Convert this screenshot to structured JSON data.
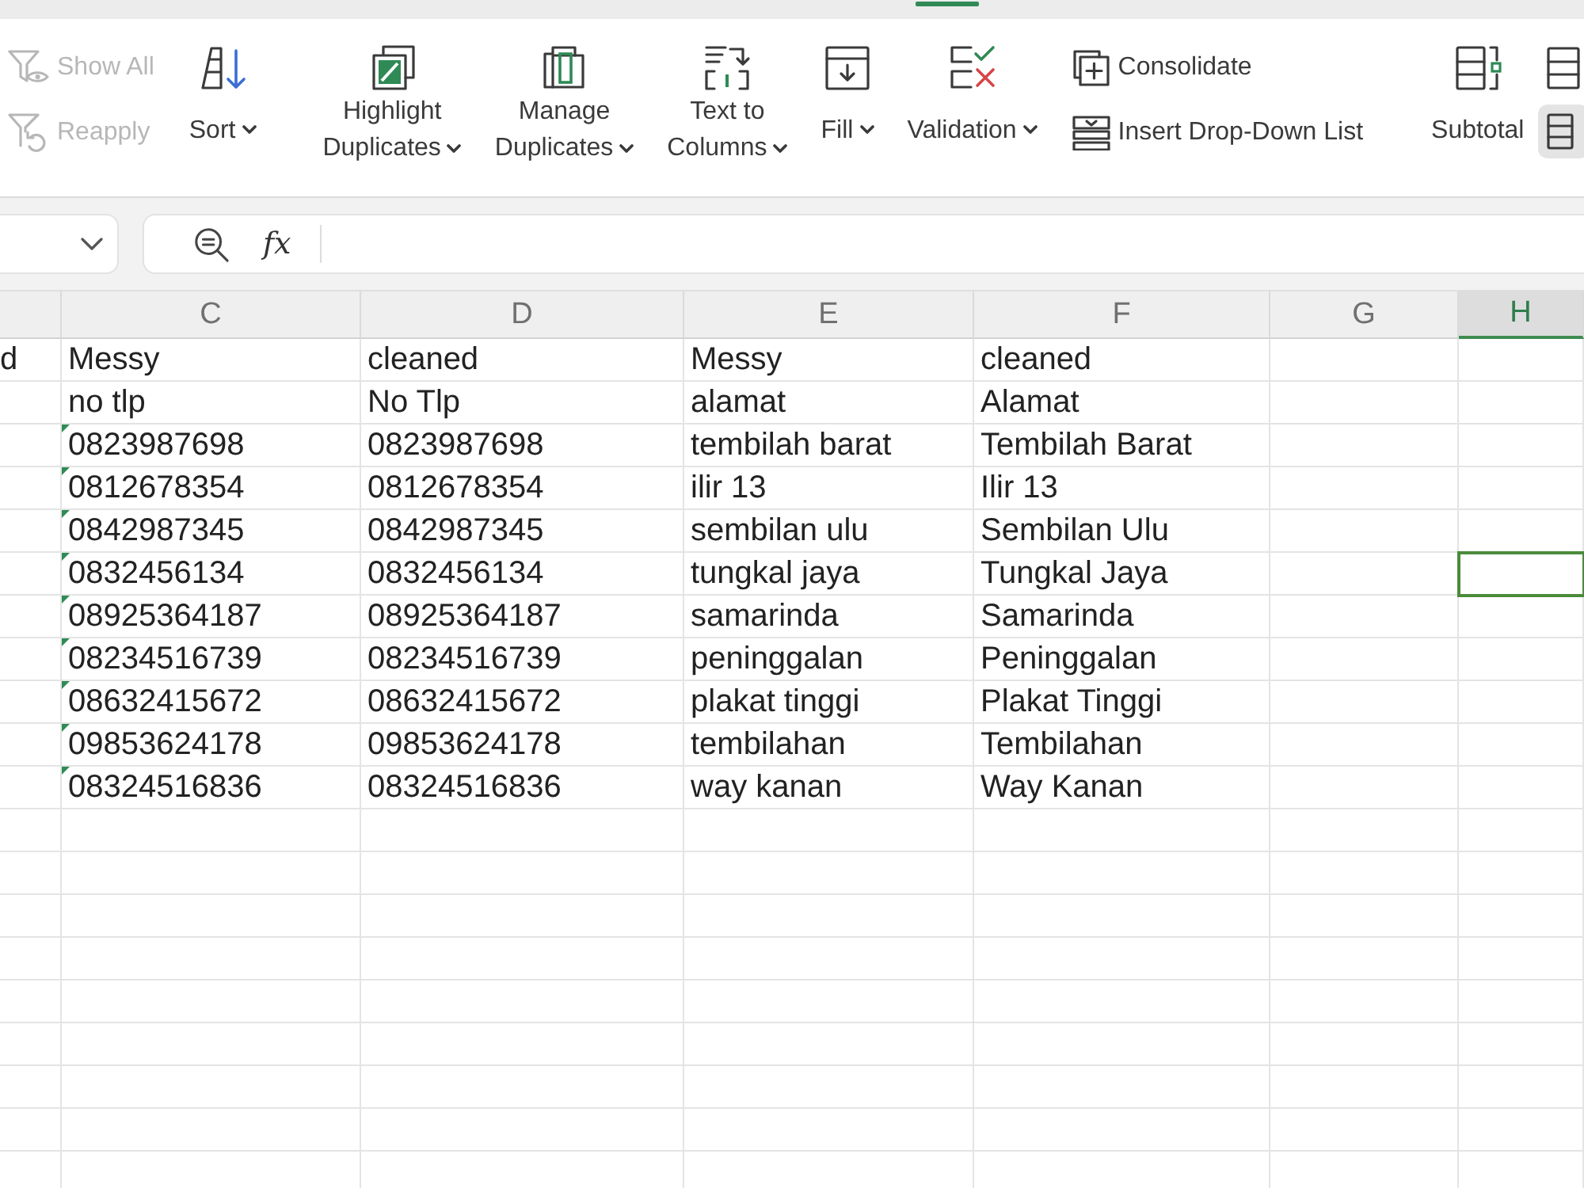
{
  "ribbon": {
    "groups": [
      {
        "controls": [
          {
            "kind": "stack",
            "items": [
              {
                "label": "Show All",
                "disabled": true
              },
              {
                "label": "Reapply",
                "disabled": true
              }
            ]
          },
          {
            "kind": "large",
            "lines": [
              "Sort"
            ],
            "dropdown": true
          }
        ]
      },
      {
        "controls": [
          {
            "kind": "large",
            "lines": [
              "Highlight",
              "Duplicates"
            ],
            "dropdown": true
          },
          {
            "kind": "large",
            "lines": [
              "Manage",
              "Duplicates"
            ],
            "dropdown": true
          },
          {
            "kind": "large",
            "lines": [
              "Text to",
              "Columns"
            ],
            "dropdown": true
          },
          {
            "kind": "large",
            "lines": [
              "Fill"
            ],
            "dropdown": true
          },
          {
            "kind": "large",
            "lines": [
              "Validation"
            ],
            "dropdown": true
          },
          {
            "kind": "stack",
            "items": [
              {
                "label": "Consolidate",
                "disabled": false
              },
              {
                "label": "Insert Drop-Down List",
                "disabled": false
              }
            ]
          }
        ]
      },
      {
        "controls": [
          {
            "kind": "large",
            "lines": [
              "Subtotal"
            ],
            "dropdown": false
          },
          {
            "kind": "icons",
            "items": [
              {
                "pressed": false
              },
              {
                "pressed": true
              }
            ]
          }
        ]
      }
    ]
  },
  "formula_bar": {
    "function_label": "fx"
  },
  "sheet": {
    "columns": [
      {
        "selected": false
      },
      {
        "letter": "C",
        "selected": false
      },
      {
        "letter": "D",
        "selected": false
      },
      {
        "letter": "E",
        "selected": false
      },
      {
        "letter": "F",
        "selected": false
      },
      {
        "letter": "G",
        "selected": false
      },
      {
        "letter": "H",
        "selected": true
      }
    ],
    "rows": [
      {
        "cells": [
          {
            "text": "d",
            "flagged": false
          },
          {
            "text": "Messy",
            "flagged": false
          },
          {
            "text": "cleaned",
            "flagged": false
          },
          {
            "text": "Messy",
            "flagged": false
          },
          {
            "text": "cleaned",
            "flagged": false
          }
        ]
      },
      {
        "cells": [
          null,
          {
            "text": "no tlp",
            "flagged": false
          },
          {
            "text": "No Tlp",
            "flagged": false
          },
          {
            "text": "alamat",
            "flagged": false
          },
          {
            "text": "Alamat",
            "flagged": false
          }
        ]
      },
      {
        "cells": [
          null,
          {
            "text": "0823987698",
            "flagged": true
          },
          {
            "text": "0823987698",
            "flagged": false
          },
          {
            "text": "tembilah barat",
            "flagged": false
          },
          {
            "text": "Tembilah Barat",
            "flagged": false
          }
        ]
      },
      {
        "cells": [
          null,
          {
            "text": "0812678354",
            "flagged": true
          },
          {
            "text": "0812678354",
            "flagged": false
          },
          {
            "text": "ilir 13",
            "flagged": false
          },
          {
            "text": "Ilir 13",
            "flagged": false
          }
        ]
      },
      {
        "cells": [
          null,
          {
            "text": "0842987345",
            "flagged": true
          },
          {
            "text": "0842987345",
            "flagged": false
          },
          {
            "text": "sembilan ulu",
            "flagged": false
          },
          {
            "text": "Sembilan Ulu",
            "flagged": false
          }
        ]
      },
      {
        "cells": [
          null,
          {
            "text": "0832456134",
            "flagged": true
          },
          {
            "text": "0832456134",
            "flagged": false
          },
          {
            "text": "tungkal jaya",
            "flagged": false
          },
          {
            "text": "Tungkal Jaya",
            "flagged": false
          },
          null,
          {
            "selected": true
          }
        ]
      },
      {
        "cells": [
          null,
          {
            "text": "08925364187",
            "flagged": true
          },
          {
            "text": "08925364187",
            "flagged": false
          },
          {
            "text": "samarinda",
            "flagged": false
          },
          {
            "text": "Samarinda",
            "flagged": false
          }
        ]
      },
      {
        "cells": [
          null,
          {
            "text": "08234516739",
            "flagged": true
          },
          {
            "text": "08234516739",
            "flagged": false
          },
          {
            "text": "peninggalan",
            "flagged": false
          },
          {
            "text": "Peninggalan",
            "flagged": false
          }
        ]
      },
      {
        "cells": [
          null,
          {
            "text": "08632415672",
            "flagged": true
          },
          {
            "text": "08632415672",
            "flagged": false
          },
          {
            "text": "plakat tinggi",
            "flagged": false
          },
          {
            "text": "Plakat Tinggi",
            "flagged": false
          }
        ]
      },
      {
        "cells": [
          null,
          {
            "text": "09853624178",
            "flagged": true
          },
          {
            "text": "09853624178",
            "flagged": false
          },
          {
            "text": "tembilahan",
            "flagged": false
          },
          {
            "text": "Tembilahan",
            "flagged": false
          }
        ]
      },
      {
        "cells": [
          null,
          {
            "text": "08324516836",
            "flagged": true
          },
          {
            "text": "08324516836",
            "flagged": false
          },
          {
            "text": "way kanan",
            "flagged": false
          },
          {
            "text": "Way Kanan",
            "flagged": false
          }
        ]
      }
    ]
  }
}
